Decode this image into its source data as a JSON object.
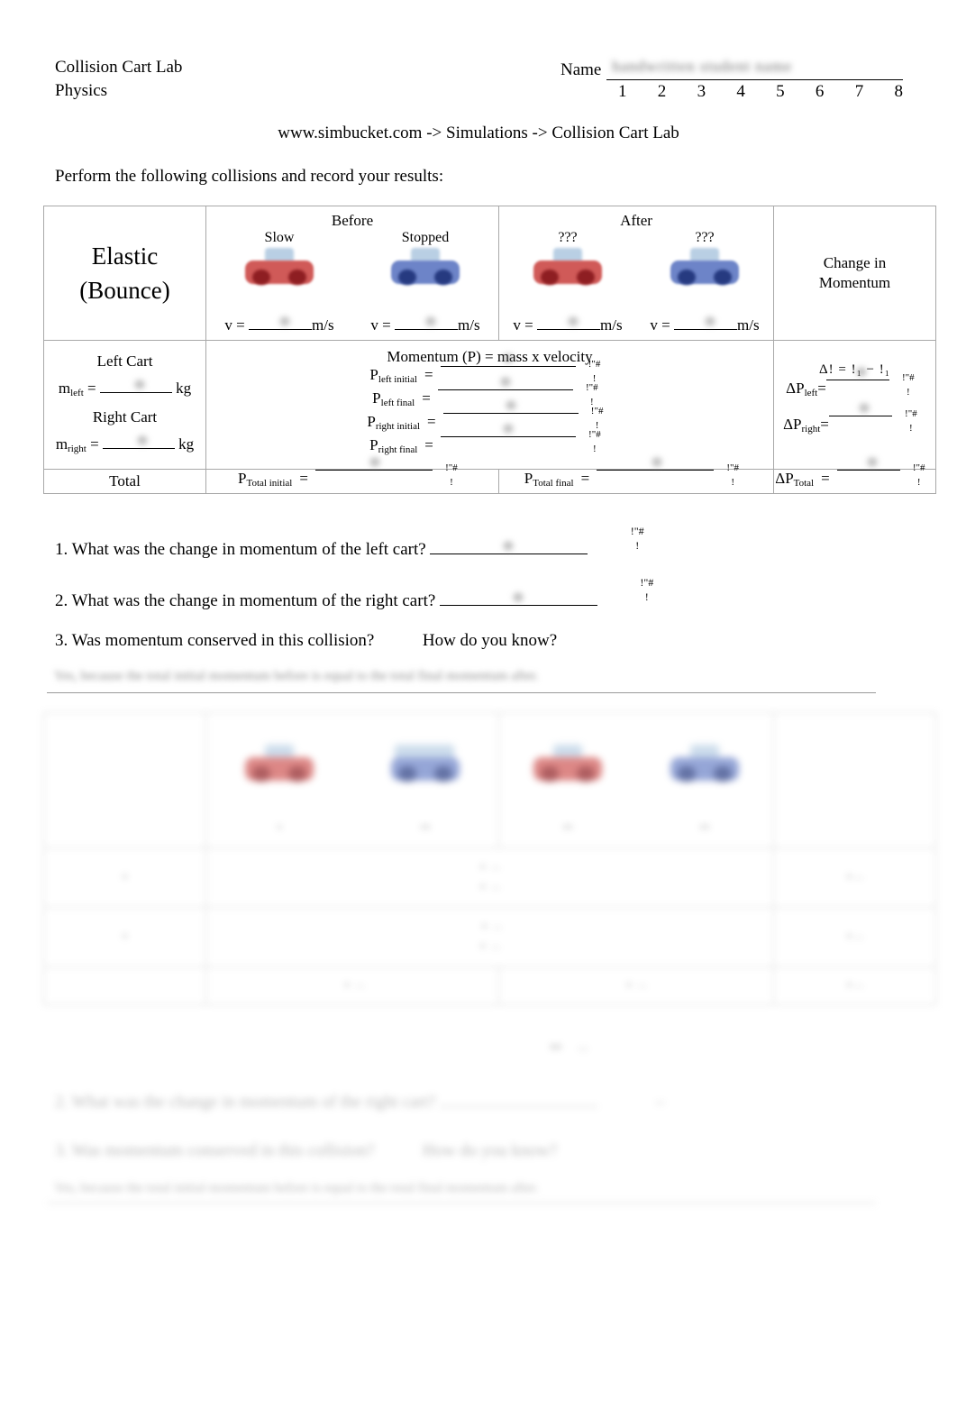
{
  "header": {
    "title": "Collision Cart Lab",
    "subject": "Physics",
    "name_label": "Name",
    "name_value": "",
    "period_numbers": [
      "1",
      "2",
      "3",
      "4",
      "5",
      "6",
      "7",
      "8"
    ],
    "source_line": "www.simbucket.com -> Simulations -> Collision Cart Lab",
    "instruction": "Perform the following collisions and record your results:"
  },
  "table": {
    "collision_type_line1": "Elastic",
    "collision_type_line2": "(Bounce)",
    "before_label": "Before",
    "after_label": "After",
    "before_captions": [
      "Slow",
      "Stopped"
    ],
    "after_captions": [
      "???",
      "???"
    ],
    "velocity_prefix": "v = ",
    "velocity_suffix": "m/s",
    "change_in_momentum_line1": "Change in",
    "change_in_momentum_line2": "Momentum",
    "left_cart_label": "Left Cart",
    "right_cart_label": "Right Cart",
    "mass_left_symbol": "m",
    "mass_left_sub": "left",
    "mass_right_symbol": "m",
    "mass_right_sub": "right",
    "mass_unit": "kg",
    "equals": "=",
    "momentum_heading": "Momentum (P) = mass x velocity",
    "momentum_rows": [
      {
        "symbol": "P",
        "sub": "left initial"
      },
      {
        "symbol": "P",
        "sub": "left final"
      },
      {
        "symbol": "P",
        "sub": "right initial"
      },
      {
        "symbol": "P",
        "sub": "right final"
      }
    ],
    "delta_heading": "Δ!  =  !₁  −  !₁",
    "delta_rows": [
      {
        "symbol": "ΔP",
        "sub": "left"
      },
      {
        "symbol": "ΔP",
        "sub": "right"
      }
    ],
    "total_label": "Total",
    "total_initial": {
      "symbol": "P",
      "sub": "Total initial"
    },
    "total_final": {
      "symbol": "P",
      "sub": "Total final"
    },
    "total_delta": {
      "symbol": "ΔP",
      "sub": "Total"
    },
    "unit_numerator": "!\"#",
    "unit_denominator": "!"
  },
  "questions": [
    {
      "number": "1.",
      "text": "What was the change in momentum of the left cart?"
    },
    {
      "number": "2.",
      "text": "What was the change in momentum of the right cart?"
    },
    {
      "number": "3.",
      "text": "Was momentum conserved in this collision?",
      "followup": "How do you know?"
    }
  ],
  "answer_line": "Yes, because the total initial momentum before is equal to the total final momentum after.",
  "ghost_block": {
    "question2": "2. What was the change in momentum of the right cart?",
    "question3": "3. Was momentum conserved in this collision?",
    "question3_followup": "How do you know?",
    "answer_line": "Yes, because the total initial momentum before is equal to the total final momentum after."
  },
  "colors": {
    "cart_red_body": "#d05a58",
    "cart_red_wheel": "#8e1e22",
    "cart_blue_body": "#6d84c8",
    "cart_blue_wheel": "#263a80",
    "cart_top": "#b9cfe4",
    "table_border": "#a8a8a8",
    "text": "#000000"
  }
}
